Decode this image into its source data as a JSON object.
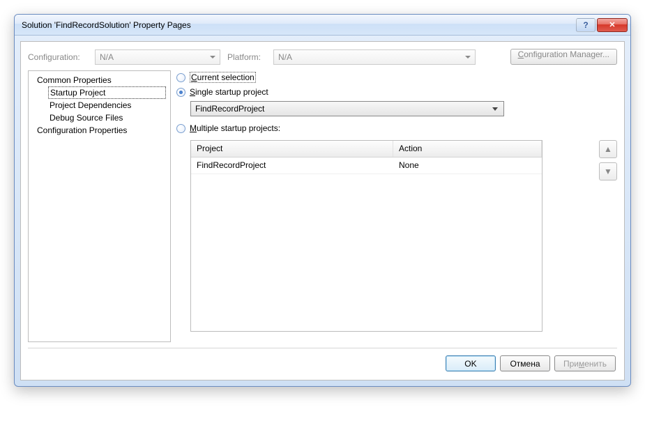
{
  "title": "Solution 'FindRecordSolution' Property Pages",
  "config_row": {
    "configuration_label": "Configuration:",
    "configuration_value": "N/A",
    "platform_label": "Platform:",
    "platform_value": "N/A",
    "manager_label_pre": "C",
    "manager_label_post": "onfiguration Manager..."
  },
  "tree": {
    "common": "Common Properties",
    "startup": "Startup Project",
    "deps": "Project Dependencies",
    "debug": "Debug Source Files",
    "cfgprops": "Configuration Properties"
  },
  "radios": {
    "current_u": "C",
    "current_rest": "urrent selection",
    "single_u": "S",
    "single_rest": "ingle startup project",
    "multi_u": "M",
    "multi_rest": "ultiple startup projects:"
  },
  "project_select": "FindRecordProject",
  "table": {
    "headers": {
      "project": "Project",
      "action": "Action"
    },
    "rows": [
      {
        "project": "FindRecordProject",
        "action": "None"
      }
    ]
  },
  "footer": {
    "ok": "OK",
    "cancel": "Отмена",
    "apply_pre": "При",
    "apply_u": "м",
    "apply_post": "енить"
  }
}
